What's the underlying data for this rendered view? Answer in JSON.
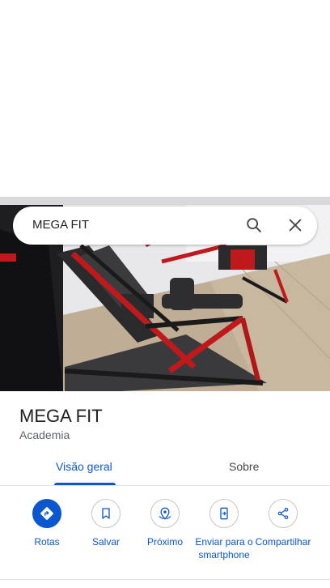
{
  "search": {
    "query": "MEGA FIT",
    "search_icon": "search-icon",
    "close_icon": "close-icon"
  },
  "photo": {
    "subject": "gym-equipment-photo"
  },
  "place": {
    "name": "MEGA FIT",
    "category": "Academia"
  },
  "tabs": [
    {
      "label": "Visão geral",
      "active": true
    },
    {
      "label": "Sobre",
      "active": false
    }
  ],
  "actions": [
    {
      "label": "Rotas",
      "icon": "directions-icon"
    },
    {
      "label": "Salvar",
      "icon": "bookmark-icon"
    },
    {
      "label": "Próximo",
      "icon": "nearby-icon"
    },
    {
      "label": "Enviar para o smartphone",
      "icon": "send-to-phone-icon"
    },
    {
      "label": "Compartilhar",
      "icon": "share-icon"
    }
  ],
  "colors": {
    "accent": "#0b57d0",
    "text": "#202124",
    "secondary_text": "#5f6368"
  }
}
